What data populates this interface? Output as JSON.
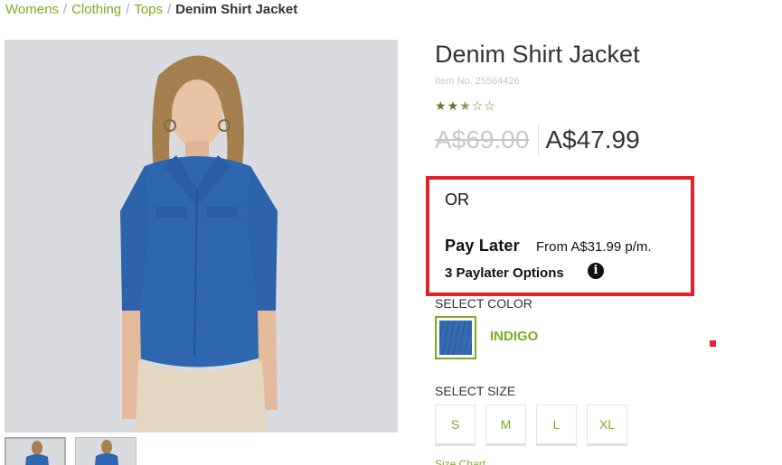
{
  "breadcrumb": {
    "items": [
      "Womens",
      "Clothing",
      "Tops"
    ],
    "separator": "/",
    "current": "Denim Shirt Jacket"
  },
  "product": {
    "title": "Denim Shirt Jacket",
    "item_no": "Item No. 25564426",
    "rating": {
      "stars_out_of_5": 2.5
    },
    "was_price": "A$69.00",
    "now_price": "A$47.99"
  },
  "paylater": {
    "or_label": "OR",
    "title": "Pay Later",
    "from_text": "From A$31.99 p/m.",
    "options_text": "3 Paylater Options",
    "info_icon": "info-icon",
    "border_color": "#e1222a"
  },
  "color": {
    "label": "SELECT COLOR",
    "selected": "INDIGO",
    "swatch_color": "#2f63a8"
  },
  "size": {
    "label": "SELECT SIZE",
    "options": [
      "S",
      "M",
      "L",
      "XL"
    ]
  },
  "size_chart_link": "Size Chart",
  "accent_color": "#7aac1e"
}
